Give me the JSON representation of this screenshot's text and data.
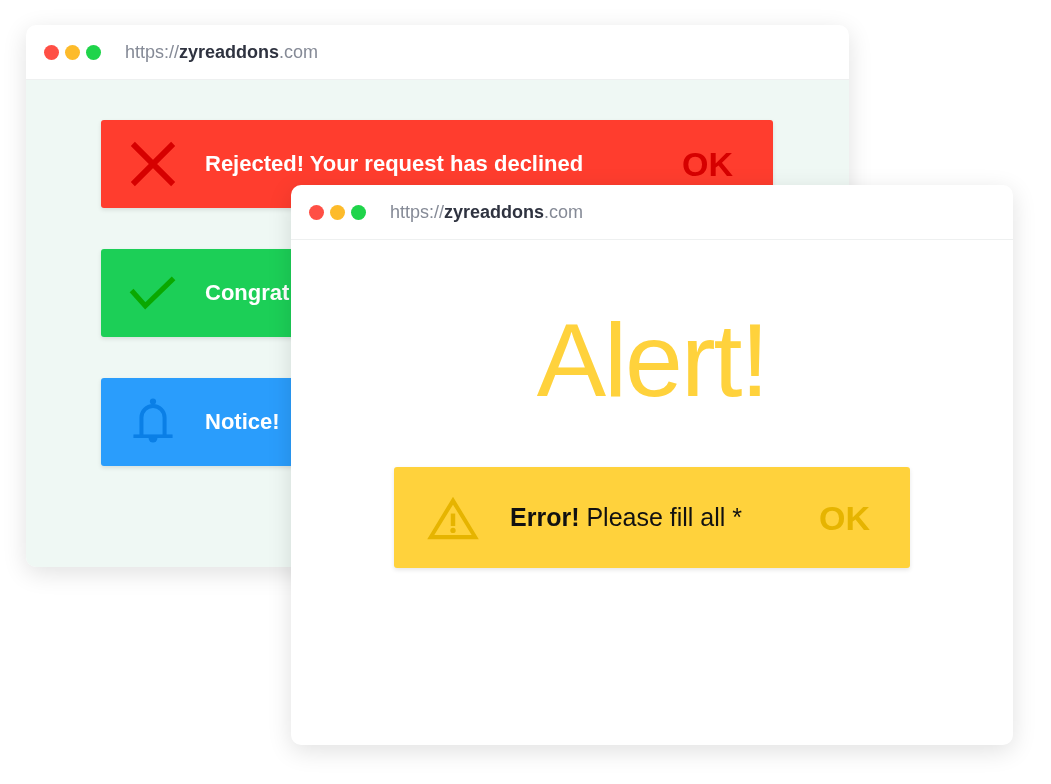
{
  "windows": [
    {
      "url": {
        "scheme": "https://",
        "domain": "zyreaddons",
        "tld": ".com"
      },
      "alerts": [
        {
          "kind": "error",
          "text": "**Rejected!** Your request has declined",
          "button": "OK"
        },
        {
          "kind": "success",
          "text": "Congrat"
        },
        {
          "kind": "info",
          "text": "Notice!"
        }
      ]
    },
    {
      "url": {
        "scheme": "https://",
        "domain": "zyreaddons",
        "tld": ".com"
      },
      "heading": "Alert!",
      "alerts": [
        {
          "kind": "warning",
          "text": "**Error!** Please fill all *",
          "button": "OK"
        }
      ]
    }
  ]
}
